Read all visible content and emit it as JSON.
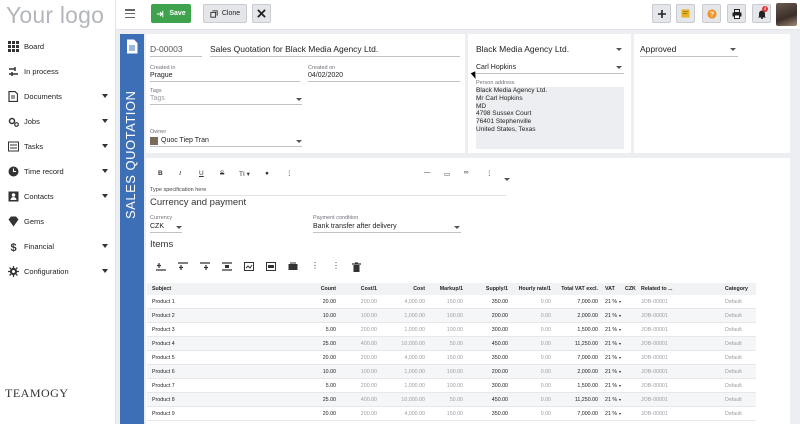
{
  "logo": {
    "text": "Your logo"
  },
  "brand": {
    "text": "TEAMOGY"
  },
  "sidebar": {
    "items": [
      {
        "label": "Board",
        "icon": "grid-icon",
        "has_caret": false
      },
      {
        "label": "In process",
        "icon": "process-icon",
        "has_caret": false
      },
      {
        "label": "Documents",
        "icon": "document-icon",
        "has_caret": true
      },
      {
        "label": "Jobs",
        "icon": "jobs-icon",
        "has_caret": true
      },
      {
        "label": "Tasks",
        "icon": "tasks-icon",
        "has_caret": true
      },
      {
        "label": "Time record",
        "icon": "clock-icon",
        "has_caret": true
      },
      {
        "label": "Contacts",
        "icon": "contacts-icon",
        "has_caret": true
      },
      {
        "label": "Gems",
        "icon": "gem-icon",
        "has_caret": false
      },
      {
        "label": "Financial",
        "icon": "dollar-icon",
        "has_caret": true
      },
      {
        "label": "Configuration",
        "icon": "gear-icon",
        "has_caret": true
      }
    ]
  },
  "toolbar": {
    "save_label": "Save",
    "clone_label": "Clone",
    "notifications_count": "4",
    "colors": {
      "save": "#3fa34d",
      "note": "#e6b422",
      "help": "#f0932b",
      "accent": "#3c6fb5"
    }
  },
  "document": {
    "type_label": "SALES QUOTATION",
    "number": "D-00003",
    "title": "Sales Quotation for Black Media Agency Ltd.",
    "created_in_label": "Created in",
    "created_in": "Prague",
    "created_on_label": "Created on",
    "created_on": "04/02/2020",
    "tags_label": "Tags",
    "tags_placeholder": "Tags",
    "owner_label": "Owner",
    "owner": "Quoc Tiep Tran"
  },
  "client": {
    "company": "Black Media Agency Ltd.",
    "person": "Carl Hopkins",
    "address_label": "Person address",
    "address_lines": [
      "Black Media Agency Ltd.",
      "Mr  Carl Hopkins",
      "MD",
      "4798  Sussex Court",
      "76401 Stephenville",
      "United States, Texas"
    ]
  },
  "status": {
    "value": "Approved"
  },
  "editor": {
    "placeholder": "Type specification here",
    "heading": "Currency and payment"
  },
  "payment": {
    "currency_label": "Currency",
    "currency": "CZK",
    "condition_label": "Payment condition",
    "condition": "Bank transfer after delivery"
  },
  "items": {
    "heading": "Items",
    "columns": [
      "Subject",
      "Count",
      "Cost/1",
      "Cost",
      "Markup/1",
      "Supply/1",
      "Hourly rate/1",
      "Total VAT excl.",
      "VAT",
      "CZK",
      "Related to ...",
      "Category"
    ],
    "rows": [
      [
        "Product 1",
        "20.00",
        "200.00",
        "4,000.00",
        "150.00",
        "350.00",
        "0.00",
        "7,000.00",
        "21 %",
        "",
        "JOB-00001",
        "Default"
      ],
      [
        "Product 2",
        "10.00",
        "100.00",
        "1,000.00",
        "100.00",
        "200.00",
        "0.00",
        "2,000.00",
        "21 %",
        "",
        "JOB-00001",
        "Default"
      ],
      [
        "Product 3",
        "5.00",
        "200.00",
        "1,000.00",
        "100.00",
        "300.00",
        "0.00",
        "1,500.00",
        "21 %",
        "",
        "JOB-00001",
        "Default"
      ],
      [
        "Product 4",
        "25.00",
        "400.00",
        "10,000.00",
        "50.00",
        "450.00",
        "0.00",
        "11,250.00",
        "21 %",
        "",
        "JOB-00001",
        "Default"
      ],
      [
        "Product 5",
        "20.00",
        "200.00",
        "4,000.00",
        "150.00",
        "350.00",
        "0.00",
        "7,000.00",
        "21 %",
        "",
        "JOB-00001",
        "Default"
      ],
      [
        "Product 6",
        "10.00",
        "100.00",
        "1,000.00",
        "100.00",
        "200.00",
        "0.00",
        "2,000.00",
        "21 %",
        "",
        "JOB-00001",
        "Default"
      ],
      [
        "Product 7",
        "5.00",
        "200.00",
        "1,000.00",
        "100.00",
        "300.00",
        "0.00",
        "1,500.00",
        "21 %",
        "",
        "JOB-00001",
        "Default"
      ],
      [
        "Product 8",
        "25.00",
        "400.00",
        "10,000.00",
        "50.00",
        "450.00",
        "0.00",
        "11,250.00",
        "21 %",
        "",
        "JOB-00001",
        "Default"
      ],
      [
        "Product 9",
        "20.00",
        "200.00",
        "4,000.00",
        "150.00",
        "350.00",
        "0.00",
        "7,000.00",
        "21 %",
        "",
        "JOB-00001",
        "Default"
      ]
    ]
  }
}
